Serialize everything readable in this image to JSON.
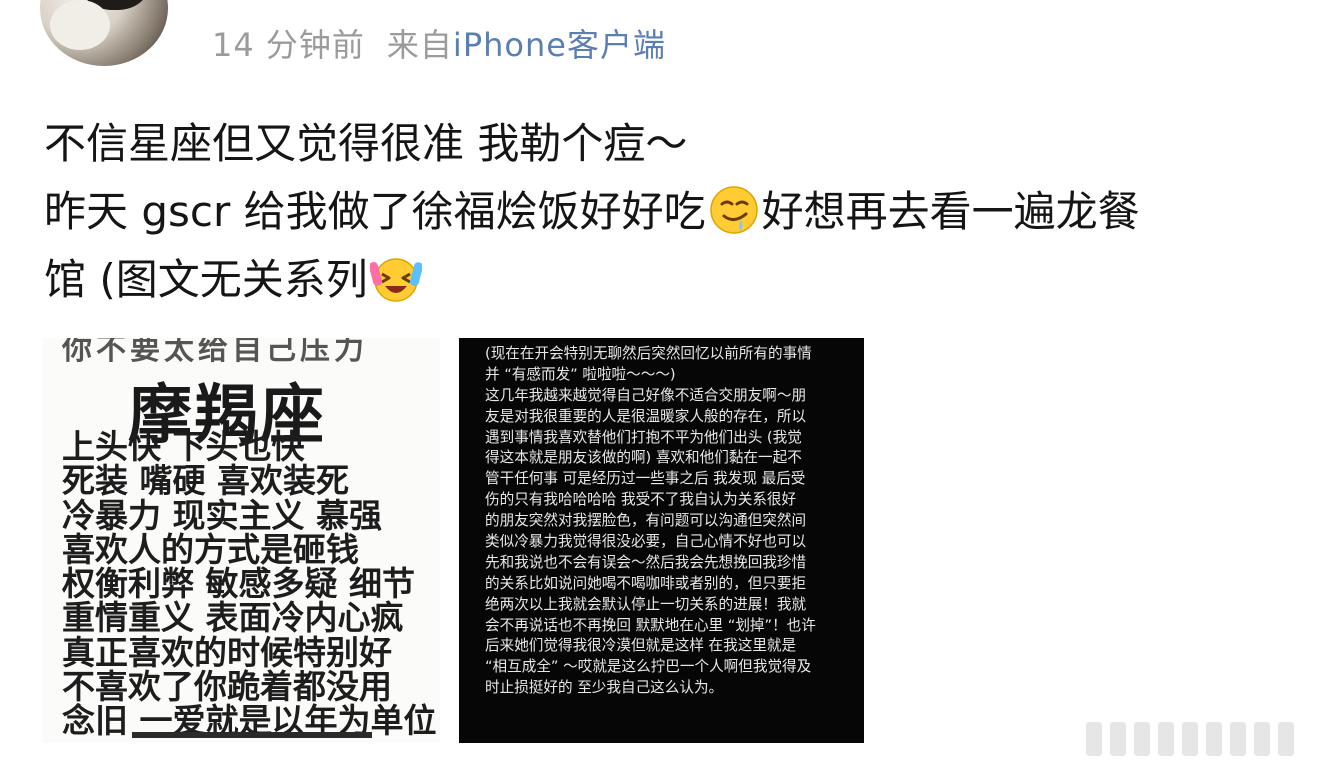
{
  "meta": {
    "time": "14 分钟前",
    "via_prefix": "来自",
    "via_source": "iPhone客户端"
  },
  "post": {
    "line1": "不信星座但又觉得很准 我勒个痘～",
    "line2_a": "昨天 gscr 给我做了徐福烩饭好好吃",
    "line2_b": "好想再去看一遍龙餐",
    "line3": "馆 (图文无关系列",
    "emoji_1": "drooling-face-emoji",
    "emoji_2": "laughing-crying-emoji"
  },
  "image_left": {
    "top_fragment": "你不要太给自己压力",
    "title": "摩羯座",
    "lines": [
      "上头快 下头也快",
      "死装 嘴硬 喜欢装死",
      "冷暴力 现实主义 慕强",
      "喜欢人的方式是砸钱",
      "权衡利弊 敏感多疑 细节",
      "重情重义 表面冷内心疯",
      "真正喜欢的时候特别好",
      "不喜欢了你跪着都没用",
      "念旧 一爱就是以年为单位"
    ]
  },
  "image_right": {
    "lines": [
      "(现在在开会特别无聊然后突然回忆以前所有的事情",
      "并 “有感而发” 啦啦啦～～～)",
      "这几年我越来越觉得自己好像不适合交朋友啊～朋",
      "友是对我很重要的人是很温暖家人般的存在，所以",
      "遇到事情我喜欢替他们打抱不平为他们出头 (我觉",
      "得这本就是朋友该做的啊) 喜欢和他们黏在一起不",
      "管干任何事 可是经历过一些事之后 我发现 最后受",
      "伤的只有我哈哈哈哈 我受不了我自认为关系很好",
      "的朋友突然对我摆脸色，有问题可以沟通但突然间",
      "类似冷暴力我觉得很没必要，自己心情不好也可以",
      "先和我说也不会有误会～然后我会先想挽回我珍惜",
      "的关系比如说问她喝不喝咖啡或者别的，但只要拒",
      "绝两次以上我就会默认停止一切关系的进展！我就",
      "会不再说话也不再挽回 默默地在心里 “划掉”！也许",
      "后来她们觉得我很冷漠但就是这样 在我这里就是",
      "“相互成全” ～哎就是这么拧巴一个人啊但我觉得及",
      "时止损挺好的 至少我自己这么认为。"
    ]
  },
  "colors": {
    "meta_gray": "#9b9b9b",
    "source_blue": "#5b7fb3",
    "post_text": "#151515"
  }
}
